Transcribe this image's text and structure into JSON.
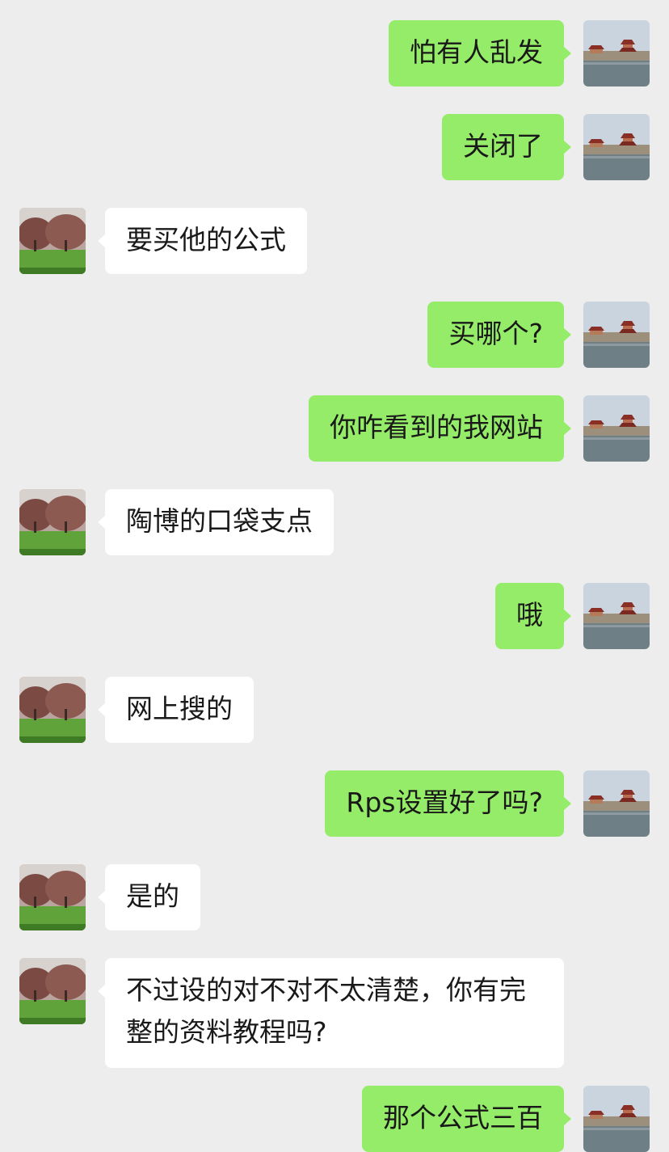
{
  "messages": [
    {
      "side": "right",
      "text": "怕有人乱发"
    },
    {
      "side": "right",
      "text": "关闭了"
    },
    {
      "side": "left",
      "text": "要买他的公式"
    },
    {
      "side": "right",
      "text": "买哪个?"
    },
    {
      "side": "right",
      "text": "你咋看到的我网站"
    },
    {
      "side": "left",
      "text": "陶博的口袋支点"
    },
    {
      "side": "right",
      "text": "哦"
    },
    {
      "side": "left",
      "text": "网上搜的"
    },
    {
      "side": "right",
      "text": "Rps设置好了吗?"
    },
    {
      "side": "left",
      "text": "是的"
    },
    {
      "side": "left",
      "text": "不过设的对不对不太清楚，你有完整的资料教程吗?"
    },
    {
      "side": "right",
      "text": "那个公式三百"
    }
  ],
  "colors": {
    "background": "#ededed",
    "sent_bubble": "#95ec69",
    "received_bubble": "#ffffff",
    "text": "#191919"
  },
  "avatars": {
    "self": "palace-lake-photo-avatar",
    "contact": "orchard-trees-photo-avatar"
  }
}
